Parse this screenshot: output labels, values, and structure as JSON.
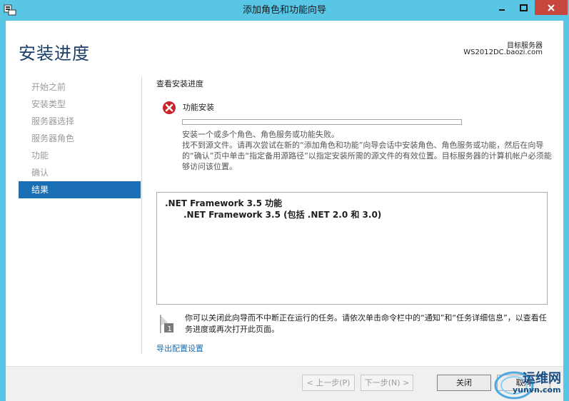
{
  "window": {
    "title": "添加角色和功能向导",
    "minimize_icon": "minimize-icon",
    "maximize_icon": "maximize-icon",
    "close_icon": "close-icon",
    "accent": "#59c6e6",
    "close_color": "#c7463e"
  },
  "header": {
    "title": "安装进度",
    "server_label": "目标服务器",
    "server_name": "WS2012DC.baozi.com"
  },
  "nav": {
    "items": [
      {
        "label": "开始之前",
        "active": false
      },
      {
        "label": "安装类型",
        "active": false
      },
      {
        "label": "服务器选择",
        "active": false
      },
      {
        "label": "服务器角色",
        "active": false
      },
      {
        "label": "功能",
        "active": false
      },
      {
        "label": "确认",
        "active": false
      },
      {
        "label": "结果",
        "active": true
      }
    ],
    "active_color": "#1a6fb4"
  },
  "content": {
    "section_title": "查看安装进度",
    "status_icon": "error-icon",
    "feature_label": "功能安装",
    "progress": 0,
    "message_line1": "安装一个或多个角色、角色服务或功能失败。",
    "message_line2": "找不到源文件。请再次尝试在新的“添加角色和功能”向导会话中安装角色、角色服务或功能，然后在向导的“确认”页中单击“指定备用源路径”以指定安装所需的源文件的有效位置。目标服务器的计算机帐户必须能够访问该位置。",
    "results": {
      "feature": ".NET Framework 3.5 功能",
      "sub_feature": ".NET Framework 3.5 (包括 .NET 2.0 和 3.0)"
    },
    "note_icon": "flag-notification-icon",
    "note": "你可以关闭此向导而不中断正在运行的任务。请依次单击命令栏中的“通知”和“任务详细信息”，以查看任务进度或再次打开此页面。",
    "export_link": "导出配置设置"
  },
  "buttons": {
    "prev": "< 上一步(P)",
    "next": "下一步(N) >",
    "close": "关闭",
    "cancel": "取消"
  },
  "watermark": {
    "text": "运维网",
    "url": "yunvn.com"
  }
}
